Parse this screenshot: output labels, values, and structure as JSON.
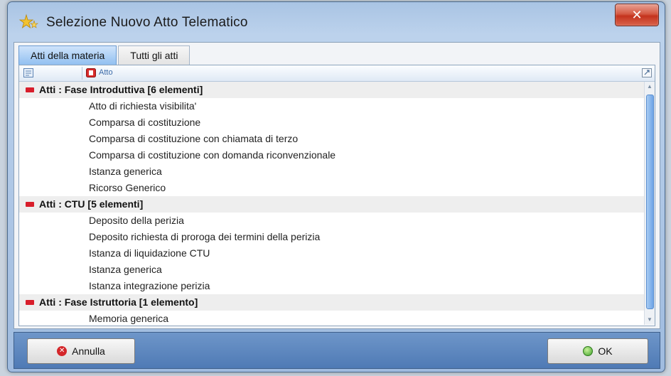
{
  "window": {
    "title": "Selezione Nuovo Atto Telematico",
    "close_label": "✕"
  },
  "tabs": [
    {
      "label": "Atti della materia",
      "active": true
    },
    {
      "label": "Tutti gli atti",
      "active": false
    }
  ],
  "grid": {
    "column_label": "Atto",
    "groups": [
      {
        "label": "Atti : Fase Introduttiva  [6 elementi]",
        "items": [
          "Atto di richiesta visibilita'",
          "Comparsa di costituzione",
          "Comparsa di costituzione con chiamata di terzo",
          "Comparsa di costituzione con domanda riconvenzionale",
          "Istanza generica",
          "Ricorso Generico"
        ]
      },
      {
        "label": "Atti : CTU  [5 elementi]",
        "items": [
          "Deposito della perizia",
          "Deposito richiesta di proroga dei termini della perizia",
          "Istanza di liquidazione CTU",
          "Istanza generica",
          "Istanza integrazione perizia"
        ]
      },
      {
        "label": "Atti : Fase Istruttoria  [1 elemento]",
        "items": [
          "Memoria generica"
        ]
      }
    ]
  },
  "footer": {
    "cancel_label": "Annulla",
    "ok_label": "OK"
  },
  "icons": {
    "app": "star-sparkle-icon",
    "collapse": "minus-icon",
    "cancel": "cancel-icon",
    "ok": "ok-icon"
  },
  "colors": {
    "accent": "#6b9bd1",
    "group_marker": "#d81e2b",
    "footer": "#5a83bc"
  }
}
